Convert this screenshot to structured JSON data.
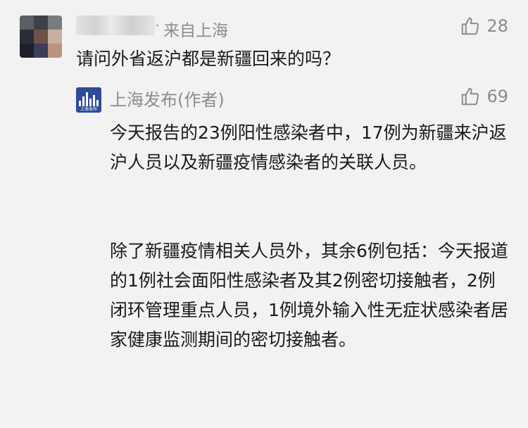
{
  "comment": {
    "source": "来自上海",
    "likes": "28",
    "text": "请问外省返沪都是新疆回来的吗？"
  },
  "reply": {
    "author": "上海发布(作者)",
    "likes": "69",
    "paragraphs": [
      "今天报告的23例阳性感染者中，17例为新疆来沪返沪人员以及新疆疫情感染者的关联人员。",
      "除了新疆疫情相关人员外，其余6例包括：今天报道的1例社会面阳性感染者及其2例密切接触者，2例闭环管理重点人员，1例境外输入性无症状感染者居家健康监测期间的密切接触者。"
    ],
    "logo_text": "上海发布"
  },
  "icons": {
    "like": "thumbs-up-icon",
    "avatar": "blurred-avatar",
    "logo": "shanghai-skyline-logo"
  },
  "colors": {
    "background": "#f2f2f2",
    "meta_gray": "#8c8c8c",
    "text": "#1a1a1a",
    "logo_blue": "#2f4a9a"
  }
}
